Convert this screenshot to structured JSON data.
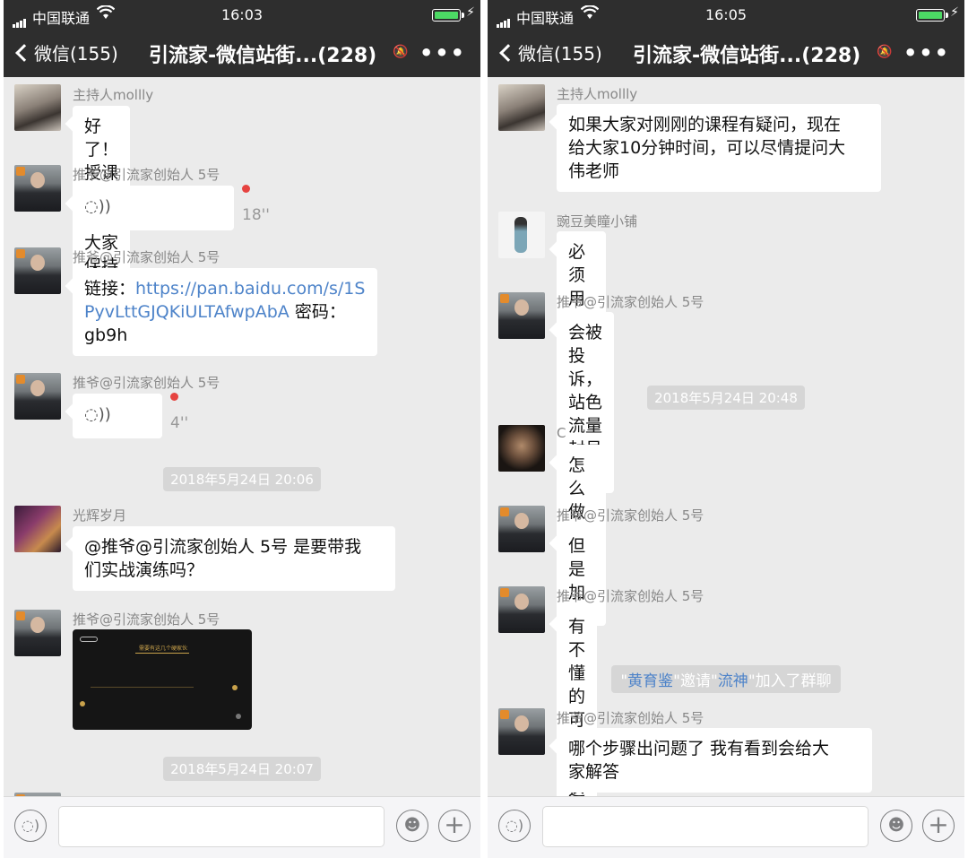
{
  "left": {
    "status": {
      "carrier": "中国联通",
      "time": "16:03"
    },
    "nav": {
      "back_label": "微信(155)",
      "title": "引流家-微信站街...(228)"
    },
    "messages": [
      {
        "nick": "主持人mollly",
        "text": "好了！授课开始！大家保持安静！"
      },
      {
        "nick": "推爷@引流家创始人 5号",
        "voice_duration": "18''"
      },
      {
        "nick": "推爷@引流家创始人 5号",
        "prefix": "链接：",
        "link": "https://pan.baidu.com/s/1SPyvLttGJQKiULTAfwpAbA",
        "link_line1": "https://pan.baidu.com/s/1S",
        "link_line2": "PyvLttGJQKiULTAfwpAbA",
        "suffix": " 密码：",
        "code": "gb9h"
      },
      {
        "nick": "推爷@引流家创始人 5号",
        "voice_duration": "4''"
      },
      {
        "nick": "光辉岁月",
        "text_line1": "@推爷@引流家创始人 5号 是要带我",
        "text_line2": "们实战演练吗？"
      },
      {
        "nick": "推爷@引流家创始人 5号",
        "image_heading": "需要有这几个硬家伙"
      }
    ],
    "timestamps": [
      "2018年5月24日 20:06",
      "2018年5月24日 20:07"
    ]
  },
  "right": {
    "status": {
      "carrier": "中国联通",
      "time": "16:05"
    },
    "nav": {
      "back_label": "微信(155)",
      "title": "引流家-微信站街...(228)"
    },
    "messages": [
      {
        "nick": "主持人mollly",
        "line1": "如果大家对刚刚的课程有疑问，现在",
        "line2": "给大家10分钟时间，可以尽情提问大",
        "line3": "伟老师"
      },
      {
        "nick": "豌豆美瞳小铺",
        "text": "必须用苹果手机?"
      },
      {
        "nick": "推爷@引流家创始人 5号",
        "text": "会被投诉，站色流量封号快"
      },
      {
        "nick": "C",
        "text": "怎么做站街号呢?"
      },
      {
        "nick": "推爷@引流家创始人 5号",
        "text": "但是加人是速度快"
      },
      {
        "nick": "推爷@引流家创始人 5号",
        "text": "有不懂的可以加这个号"
      },
      {
        "nick": "推爷@引流家创始人 5号",
        "line1": "哪个步骤出问题了  我有看到会给大",
        "line2": "家解答"
      }
    ],
    "timestamps": [
      "2018年5月24日 20:48"
    ],
    "system": {
      "q1": "\"",
      "name1": "黄育鉴",
      "mid": "\"邀请\"",
      "name2": "流神",
      "tail": "\"加入了群聊"
    }
  },
  "colors": {
    "bar": "#2e2e2e",
    "chat_bg": "#ebebeb",
    "link": "#4d83c9",
    "unread": "#e64340",
    "battery": "#4cd964"
  },
  "icons": [
    "signal-icon",
    "wifi-icon",
    "battery-icon",
    "back-chevron-icon",
    "mute-icon",
    "more-icon",
    "voice-icon",
    "emoji-icon",
    "plus-icon"
  ]
}
